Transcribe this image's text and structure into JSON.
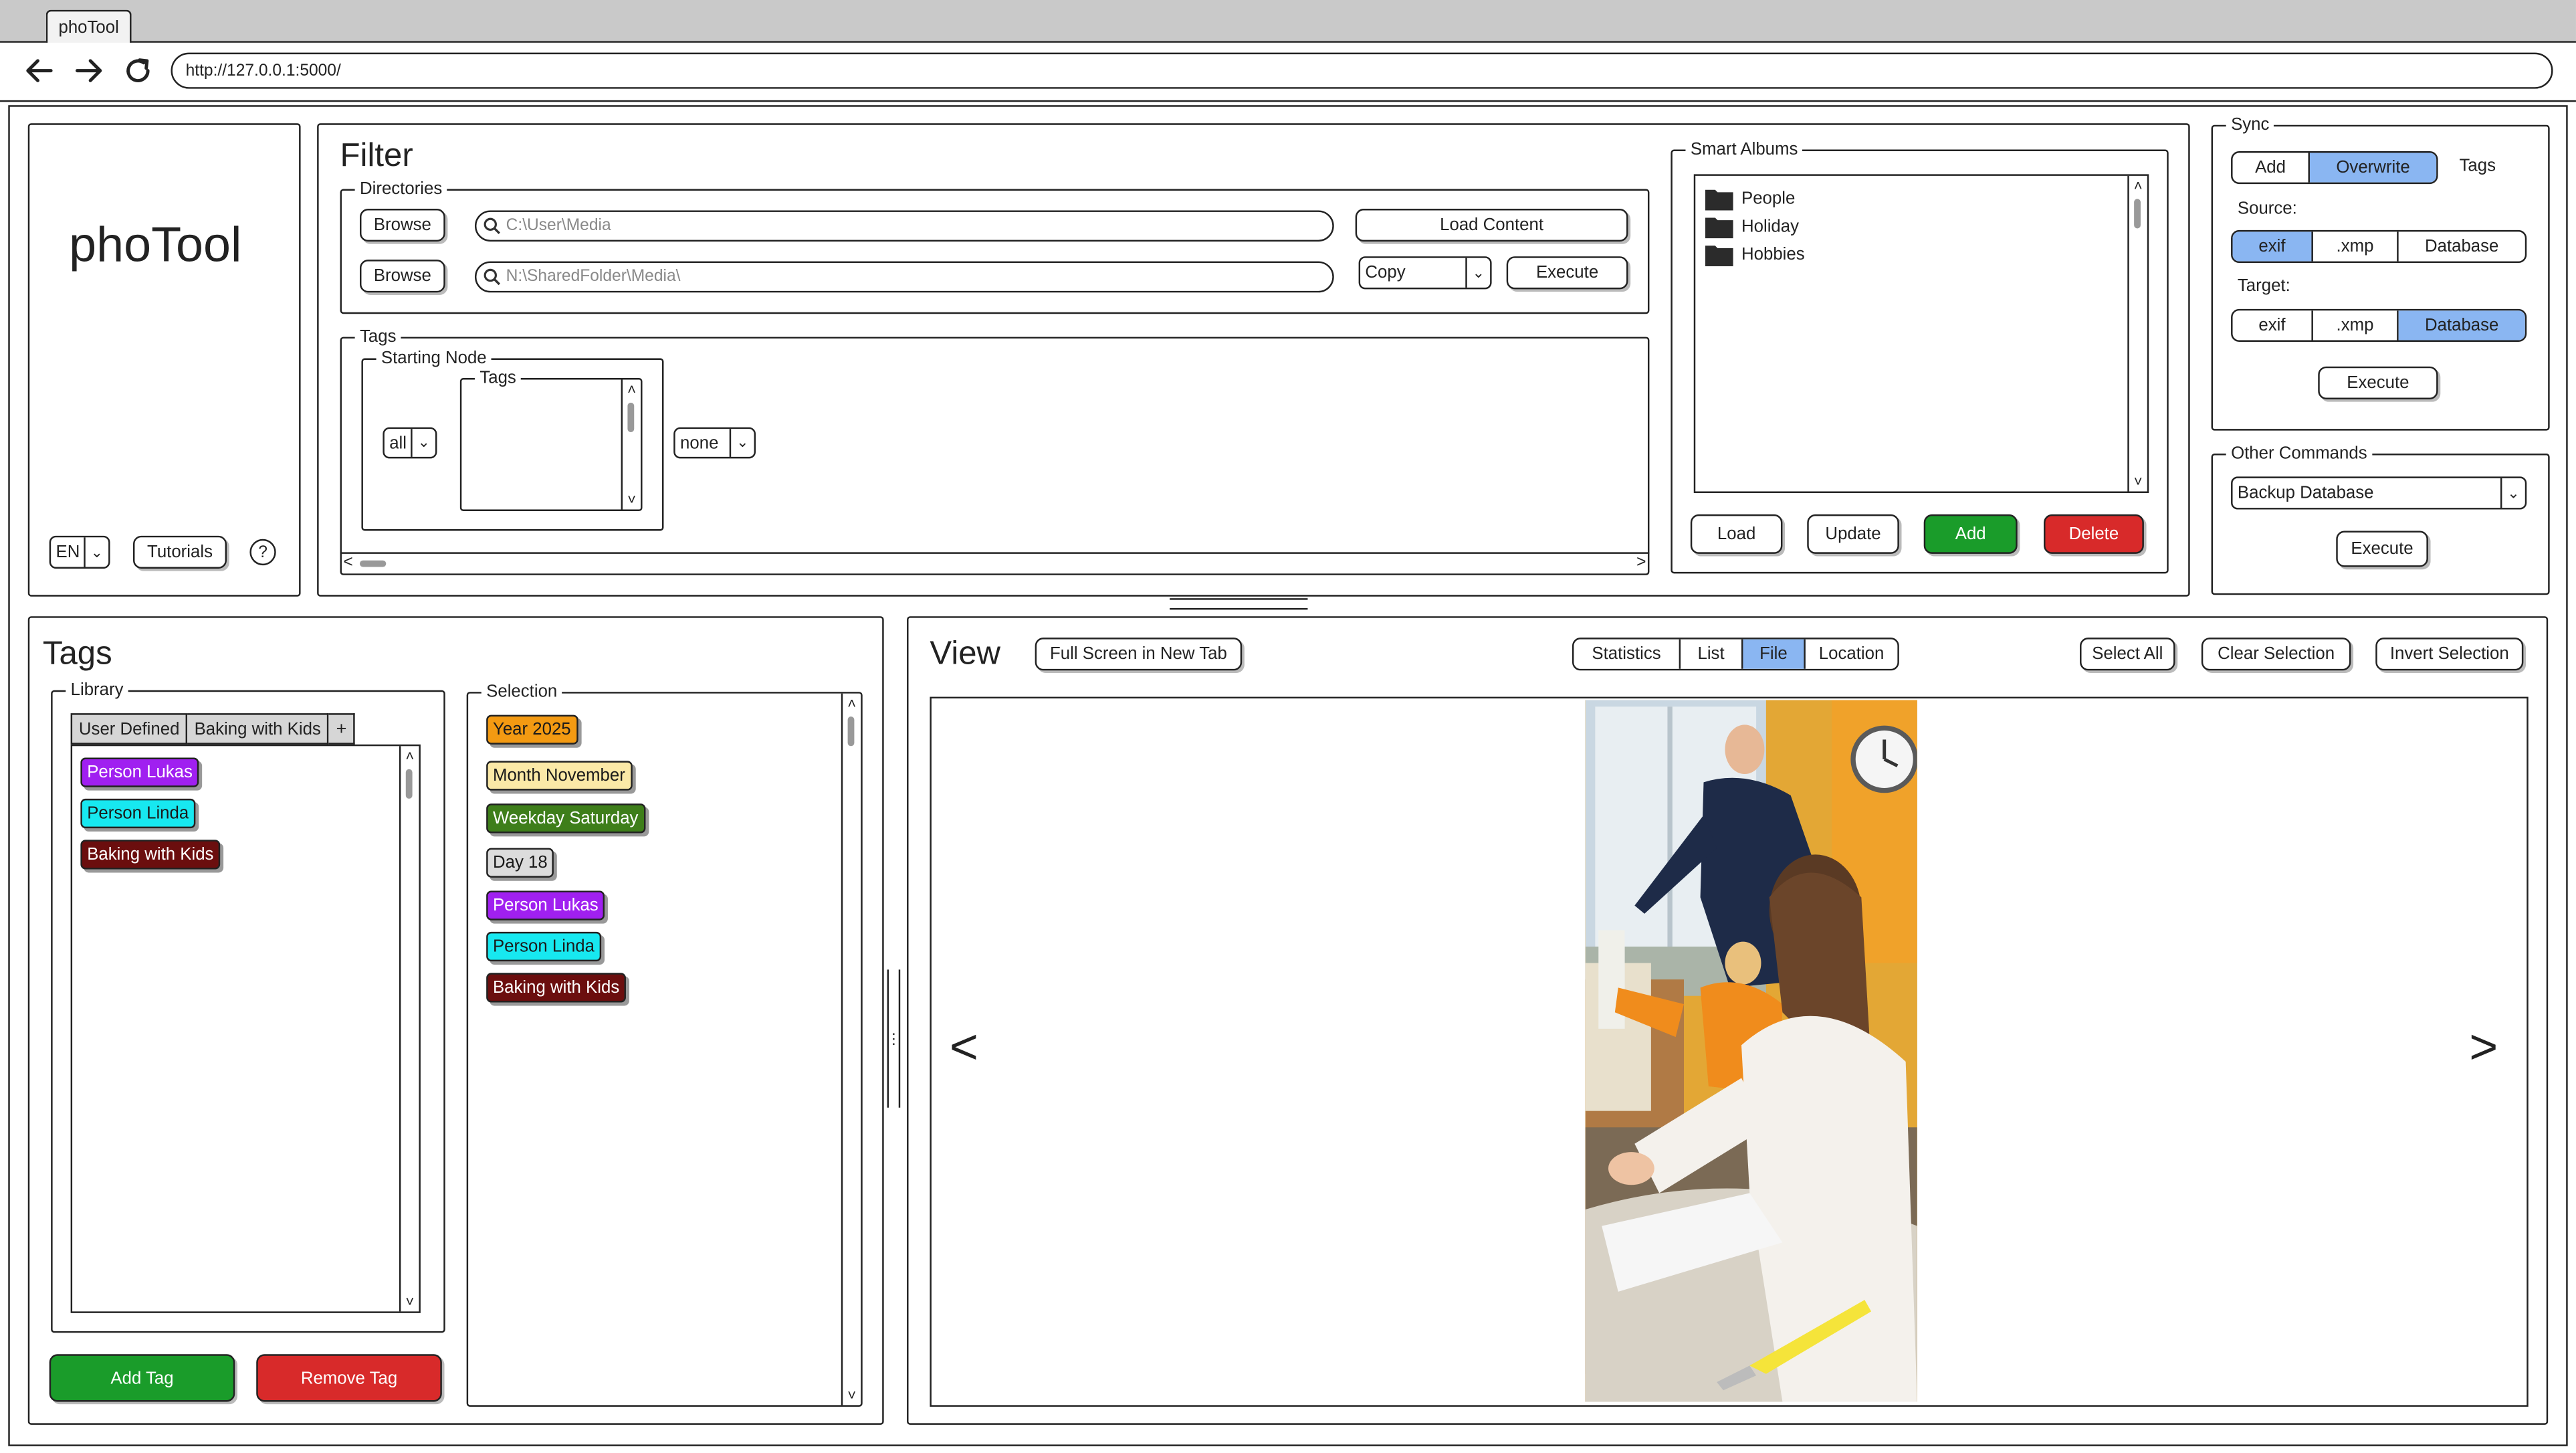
{
  "browser": {
    "tab_title": "phoTool",
    "url": "http://127.0.0.1:5000/"
  },
  "brand": {
    "logo": "phoTool",
    "language": "EN",
    "tutorials_label": "Tutorials",
    "help_symbol": "?"
  },
  "filter": {
    "title": "Filter",
    "directories": {
      "legend": "Directories",
      "browse_label": "Browse",
      "source_placeholder": "C:\\User\\Media",
      "target_placeholder": "N:\\SharedFolder\\Media\\",
      "load_content_label": "Load Content",
      "operation": "Copy",
      "execute_label": "Execute"
    },
    "tags": {
      "legend": "Tags",
      "starting_node_legend": "Starting Node",
      "tags_legend": "Tags",
      "scope": "all",
      "mode": "none"
    }
  },
  "smart_albums": {
    "legend": "Smart Albums",
    "items": [
      "People",
      "Holiday",
      "Hobbies"
    ],
    "load_label": "Load",
    "update_label": "Update",
    "add_label": "Add",
    "delete_label": "Delete"
  },
  "sync": {
    "legend": "Sync",
    "mode_options": [
      "Add",
      "Overwrite"
    ],
    "active_mode": "Overwrite",
    "tags_label": "Tags",
    "source_label": "Source:",
    "target_label": "Target:",
    "source_options": [
      "exif",
      ".xmp",
      "Database"
    ],
    "active_source": "exif",
    "target_options": [
      "exif",
      ".xmp",
      "Database"
    ],
    "active_target": "Database",
    "execute_label": "Execute"
  },
  "other_commands": {
    "legend": "Other Commands",
    "selected": "Backup Database",
    "execute_label": "Execute"
  },
  "tags_panel": {
    "title": "Tags",
    "library_legend": "Library",
    "library_tabs": [
      "User Defined",
      "Baking with Kids",
      "+"
    ],
    "library_tags": [
      {
        "label": "Person Lukas",
        "color": "#a020f0",
        "text": "#ffffff"
      },
      {
        "label": "Person Linda",
        "color": "#17e8f0",
        "text": "#1a1a1a"
      },
      {
        "label": "Baking with Kids",
        "color": "#6b0e0e",
        "text": "#ffffff"
      }
    ],
    "selection_legend": "Selection",
    "selection_tags": [
      {
        "label": "Year 2025",
        "color": "#f39a12",
        "text": "#1a1a1a"
      },
      {
        "label": "Month November",
        "color": "#fbe9a7",
        "text": "#1a1a1a"
      },
      {
        "label": "Weekday Saturday",
        "color": "#3e7e1a",
        "text": "#ffffff"
      },
      {
        "label": "Day 18",
        "color": "#dcdcdc",
        "text": "#1a1a1a"
      },
      {
        "label": "Person Lukas",
        "color": "#a020f0",
        "text": "#ffffff"
      },
      {
        "label": "Person Linda",
        "color": "#17e8f0",
        "text": "#1a1a1a"
      },
      {
        "label": "Baking with Kids",
        "color": "#6b0e0e",
        "text": "#ffffff"
      }
    ],
    "add_tag_label": "Add Tag",
    "remove_tag_label": "Remove Tag"
  },
  "view": {
    "title": "View",
    "fullscreen_label": "Full Screen in New Tab",
    "modes": [
      "Statistics",
      "List",
      "File",
      "Location"
    ],
    "active_mode": "File",
    "select_all_label": "Select All",
    "clear_selection_label": "Clear Selection",
    "invert_selection_label": "Invert Selection",
    "prev_symbol": "<",
    "next_symbol": ">"
  },
  "colors": {
    "accent_selected": "#8ab6f2",
    "add_green": "#1a9c2a",
    "delete_red": "#d82a2a"
  }
}
